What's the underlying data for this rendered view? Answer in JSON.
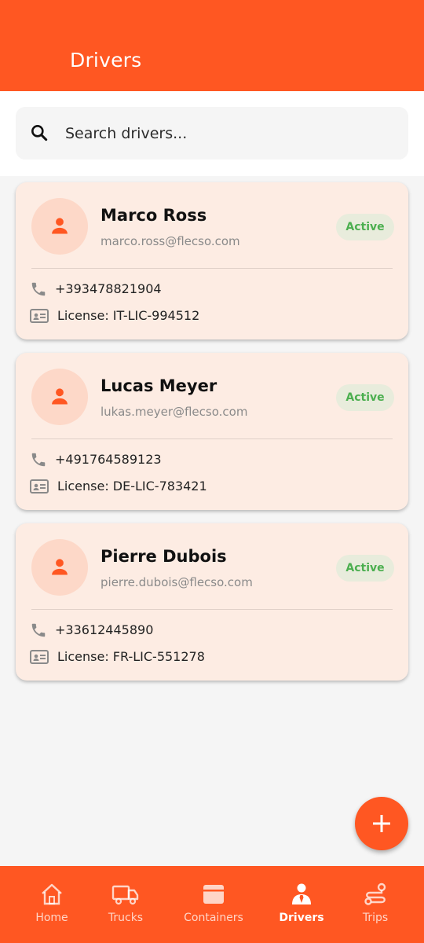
{
  "appbar": {
    "title": "Drivers"
  },
  "search": {
    "placeholder": "Search drivers...",
    "icon": "search-icon"
  },
  "drivers": [
    {
      "name": "Marco Ross",
      "email": "marco.ross@flecso.com",
      "status": "Active",
      "phone": "+393478821904",
      "license": "License: IT-LIC-994512"
    },
    {
      "name": "Lucas Meyer",
      "email": "lukas.meyer@flecso.com",
      "status": "Active",
      "phone": "+491764589123",
      "license": "License: DE-LIC-783421"
    },
    {
      "name": "Pierre Dubois",
      "email": "pierre.dubois@flecso.com",
      "status": "Active",
      "phone": "+33612445890",
      "license": "License: FR-LIC-551278"
    }
  ],
  "fab": {
    "icon": "plus-icon"
  },
  "nav": {
    "items": [
      {
        "label": "Home",
        "icon": "home-icon"
      },
      {
        "label": "Trucks",
        "icon": "truck-icon"
      },
      {
        "label": "Containers",
        "icon": "container-icon"
      },
      {
        "label": "Drivers",
        "icon": "driver-icon",
        "active": true
      },
      {
        "label": "Trips",
        "icon": "route-icon"
      }
    ]
  },
  "colors": {
    "primary": "#ff5722",
    "card": "#fdece3",
    "active_status": "#4caf50"
  }
}
